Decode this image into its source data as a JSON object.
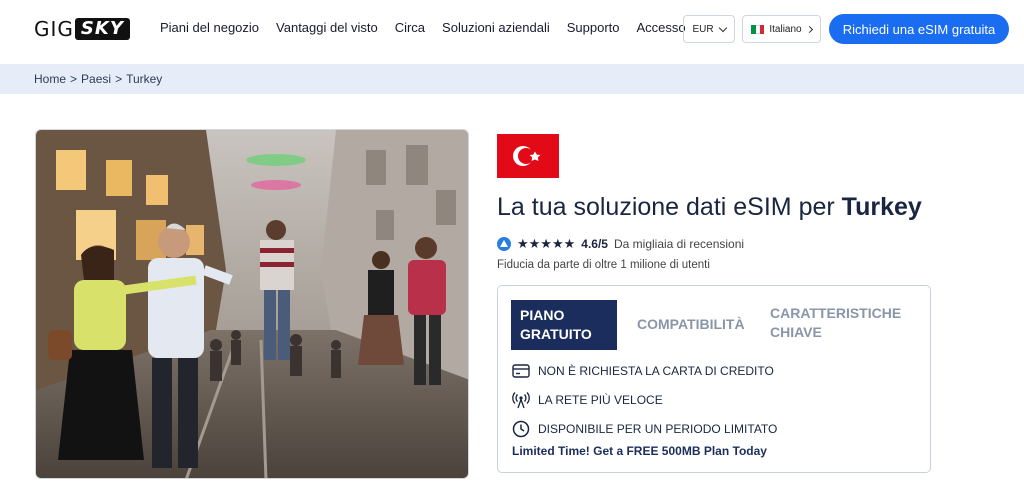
{
  "logo": {
    "part1": "GIG",
    "part2": "SKY"
  },
  "nav": [
    {
      "label": "Piani del negozio"
    },
    {
      "label": "Vantaggi del visto"
    },
    {
      "label": "Circa"
    },
    {
      "label": "Soluzioni aziendali"
    },
    {
      "label": "Supporto"
    },
    {
      "label": "Accesso"
    }
  ],
  "currency": {
    "value": "EUR"
  },
  "language": {
    "value": "Italiano"
  },
  "cta": {
    "label": "Richiedi una eSIM gratuita"
  },
  "breadcrumb": [
    "Home",
    ">",
    "Paesi",
    ">",
    "Turkey"
  ],
  "headline": {
    "prefix": "La tua soluzione dati eSIM per",
    "country": "Turkey"
  },
  "rating": {
    "stars": "★★★★★",
    "score": "4.6/5",
    "reviews": "Da migliaia di recensioni"
  },
  "trust": "Fiducia da parte di oltre 1 milione di utenti",
  "tabs": [
    {
      "line1": "PIANO",
      "line2": "GRATUITO"
    },
    {
      "line1": "COMPATIBILITÀ",
      "line2": ""
    },
    {
      "line1": "CARATTERISTICHE",
      "line2": "CHIAVE"
    }
  ],
  "features": [
    {
      "icon": "credit-card-icon",
      "label": "NON È RICHIESTA LA CARTA DI CREDITO"
    },
    {
      "icon": "antenna-icon",
      "label": "LA RETE PIÙ VELOCE"
    },
    {
      "icon": "clock-icon",
      "label": "DISPONIBILE PER UN PERIODO LIMITATO"
    }
  ],
  "promo": "Limited Time! Get a FREE 500MB Plan Today",
  "colors": {
    "accent": "#1a6cf0",
    "navy": "#1a2d5c",
    "flag_red": "#e30a17",
    "crumb_bg": "#e6edf8"
  }
}
